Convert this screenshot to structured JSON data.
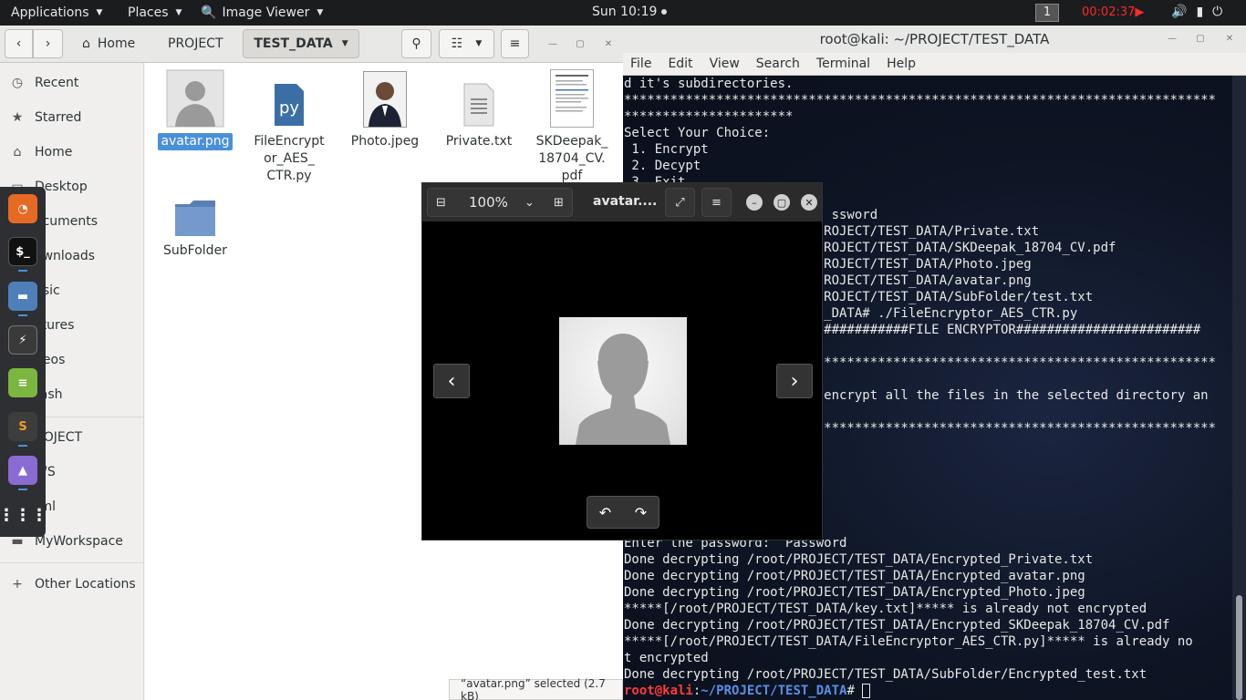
{
  "topbar": {
    "applications": "Applications",
    "places": "Places",
    "image_viewer": "Image Viewer",
    "clock": "Sun 10:19",
    "workspace": "1",
    "record_timer": "00:02:37"
  },
  "files": {
    "home_label": "Home",
    "path1": "PROJECT",
    "path2": "TEST_DATA",
    "sidebar": [
      {
        "icon": "clock-icon",
        "label": "Recent"
      },
      {
        "icon": "star-icon",
        "label": "Starred"
      },
      {
        "icon": "home-icon",
        "label": "Home"
      },
      {
        "icon": "desktop-icon",
        "label": "Desktop"
      },
      {
        "icon": "documents-icon",
        "label": "ocuments"
      },
      {
        "icon": "downloads-icon",
        "label": "ownloads"
      },
      {
        "icon": "music-icon",
        "label": "usic"
      },
      {
        "icon": "pictures-icon",
        "label": "ctures"
      },
      {
        "icon": "videos-icon",
        "label": "deos"
      },
      {
        "icon": "trash-icon",
        "label": "rash"
      },
      {
        "icon": "folder-icon",
        "label": "ROJECT"
      },
      {
        "icon": "folder-icon",
        "label": "WS"
      },
      {
        "icon": "folder-icon",
        "label": "tml"
      },
      {
        "icon": "folder-icon",
        "label": "MyWorkspace"
      },
      {
        "icon": "plus-icon",
        "label": "Other Locations"
      }
    ],
    "items": [
      {
        "name": "avatar.png",
        "type": "image",
        "selected": true
      },
      {
        "name": "FileEncrypt or_AES_ CTR.py",
        "type": "python"
      },
      {
        "name": "Photo.jpeg",
        "type": "photo"
      },
      {
        "name": "Private.txt",
        "type": "text"
      },
      {
        "name": "SKDeepak_ 18704_CV. pdf",
        "type": "pdf"
      },
      {
        "name": "SubFolder",
        "type": "folder"
      }
    ],
    "status": "“avatar.png” selected  (2.7 kB)"
  },
  "terminal": {
    "title": "root@kali: ~/PROJECT/TEST_DATA",
    "menu": [
      "File",
      "Edit",
      "View",
      "Search",
      "Terminal",
      "Help"
    ],
    "lines": [
      "d it's subdirectories.",
      "*****************************************************************************",
      "**********************",
      "Select Your Choice:",
      " 1. Encrypt",
      " 2. Decypt",
      " 3. Exit",
      "",
      "                           ssword",
      "                          ROJECT/TEST_DATA/Private.txt",
      "                          ROJECT/TEST_DATA/SKDeepak_18704_CV.pdf",
      "                          ROJECT/TEST_DATA/Photo.jpeg",
      "                          ROJECT/TEST_DATA/avatar.png",
      "                          ROJECT/TEST_DATA/SubFolder/test.txt",
      "                          _DATA# ./FileEncryptor_AES_CTR.py",
      "                          ###########FILE ENCRYPTOR########################",
      "",
      "                          ***************************************************",
      "",
      "                          encrypt all the files in the selected directory an",
      "",
      "                          ***************************************************",
      "",
      "",
      "",
      "",
      "",
      "",
      "Enter the password:  Password",
      "Done decrypting /root/PROJECT/TEST_DATA/Encrypted_Private.txt",
      "Done decrypting /root/PROJECT/TEST_DATA/Encrypted_avatar.png",
      "Done decrypting /root/PROJECT/TEST_DATA/Encrypted_Photo.jpeg",
      "*****[/root/PROJECT/TEST_DATA/key.txt]***** is already not encrypted",
      "Done decrypting /root/PROJECT/TEST_DATA/Encrypted_SKDeepak_18704_CV.pdf",
      "*****[/root/PROJECT/TEST_DATA/FileEncryptor_AES_CTR.py]***** is already no",
      "t encrypted",
      "Done decrypting /root/PROJECT/TEST_DATA/SubFolder/Encrypted_test.txt"
    ],
    "prompt_user": "root@kali",
    "prompt_path": "~/PROJECT/TEST_DATA",
    "prompt_sep": ":",
    "prompt_end": "# "
  },
  "viewer": {
    "zoom": "100%",
    "title": "avatar...."
  }
}
